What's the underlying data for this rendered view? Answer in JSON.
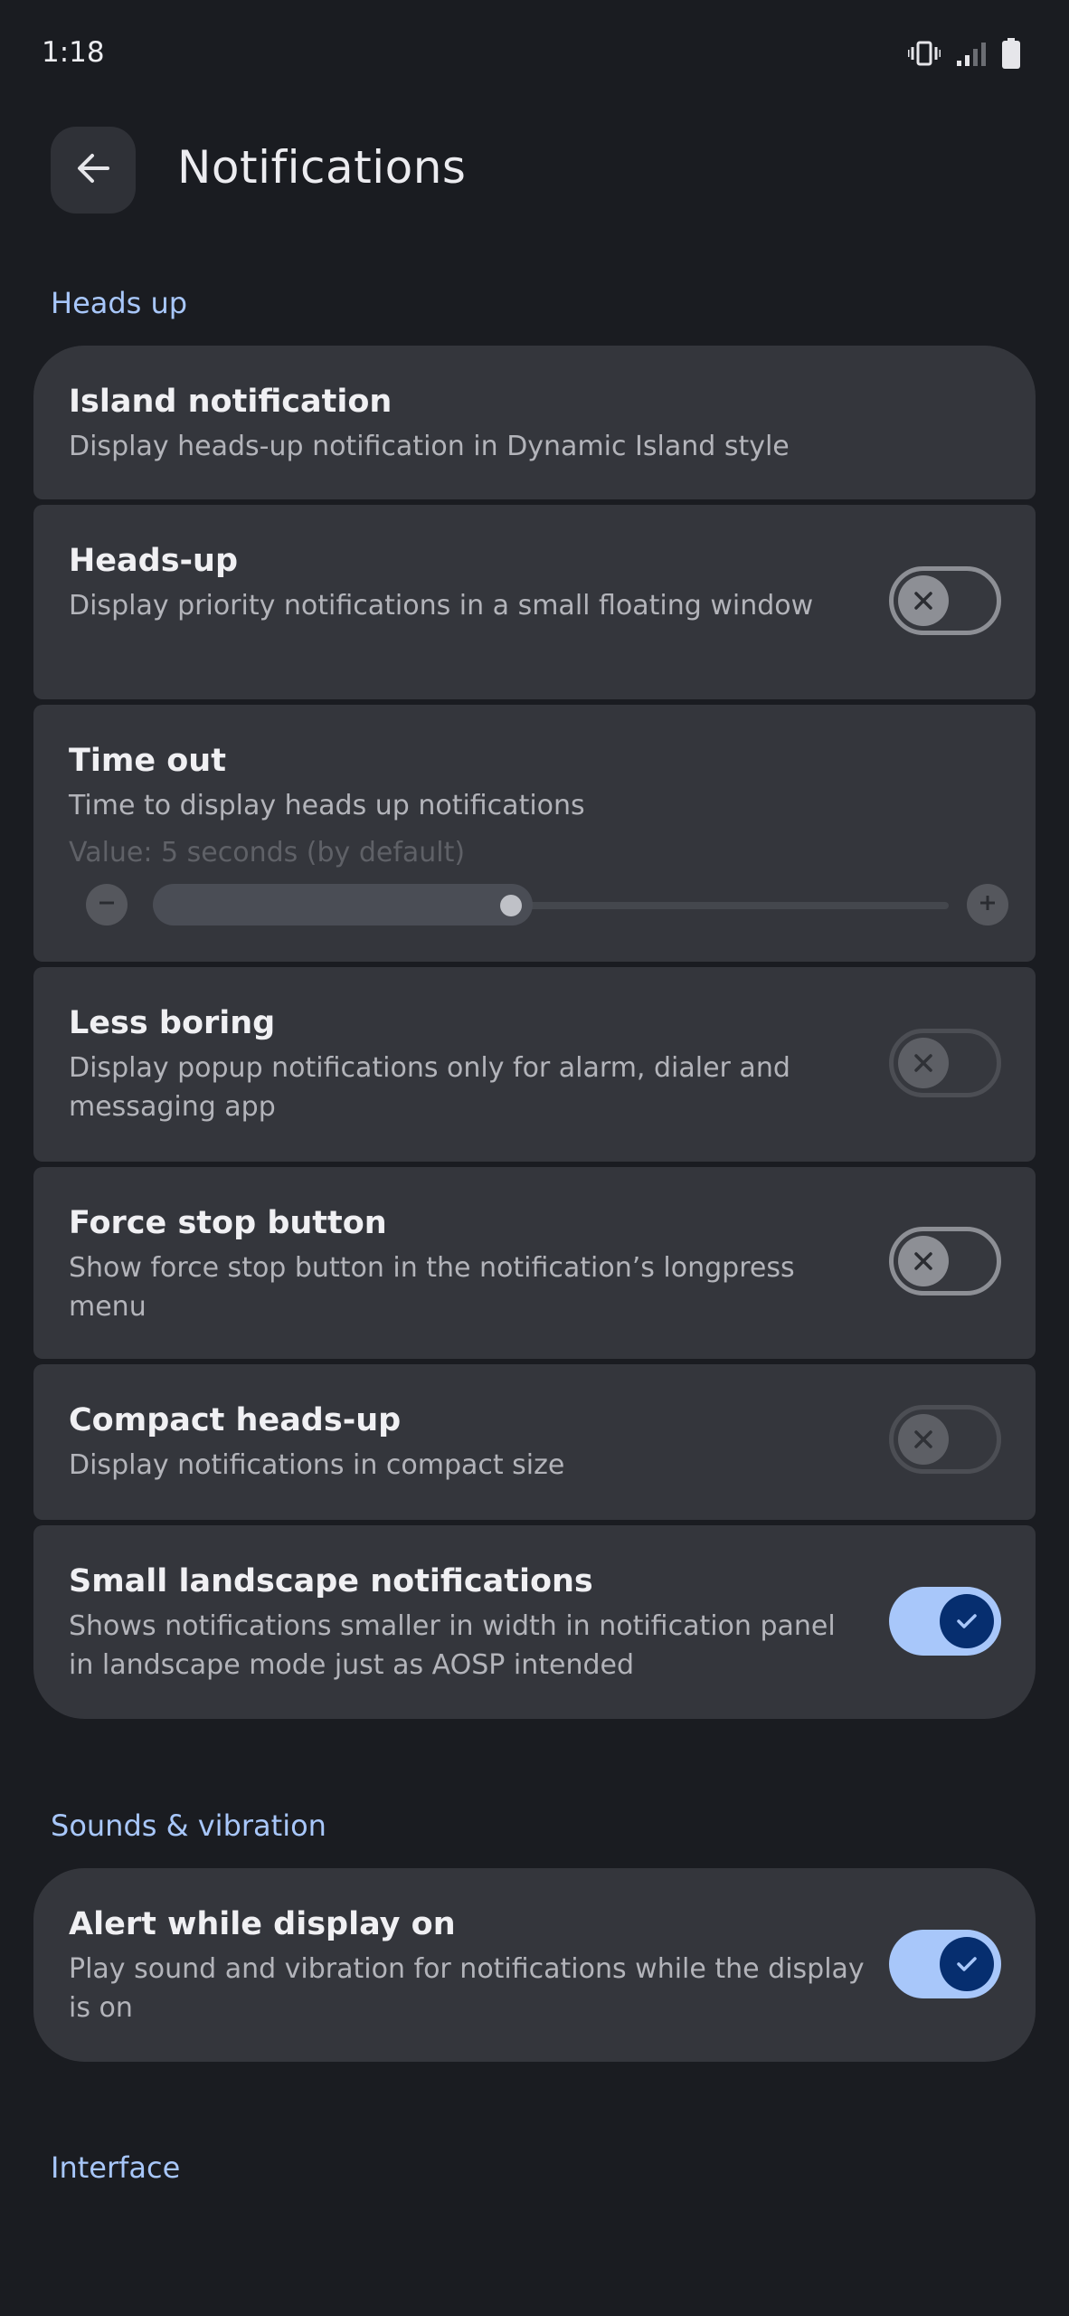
{
  "status_bar": {
    "time": "1:18",
    "icons": [
      "vibrate-icon",
      "signal-icon",
      "battery-icon"
    ]
  },
  "header": {
    "back_icon": "arrow-left-icon",
    "title": "Notifications"
  },
  "sections": {
    "heads_up": "Heads up",
    "sounds": "Sounds & vibration",
    "interface": "Interface"
  },
  "items": {
    "island": {
      "title": "Island notification",
      "subtitle": "Display heads-up notification in Dynamic Island style"
    },
    "heads_up": {
      "title": "Heads-up",
      "subtitle": "Display priority notifications in a small floating window",
      "enabled": false
    },
    "time_out": {
      "title": "Time out",
      "subtitle": "Time to display heads up notifications",
      "value_text": "Value: 5 seconds (by default)",
      "slider_fraction": 0.45
    },
    "less_boring": {
      "title": "Less boring",
      "subtitle": "Display popup notifications only for alarm, dialer and messaging app",
      "enabled": false,
      "disabled": true
    },
    "force_stop": {
      "title": "Force stop button",
      "subtitle": "Show force stop button in the notification’s longpress menu",
      "enabled": false
    },
    "compact": {
      "title": "Compact heads-up",
      "subtitle": "Display notifications in compact size",
      "enabled": false,
      "disabled": true
    },
    "small_landscape": {
      "title": "Small landscape notifications",
      "subtitle": "Shows notifications smaller in width in notification panel in landscape mode just as AOSP intended",
      "enabled": true
    },
    "alert_display_on": {
      "title": "Alert while display on",
      "subtitle": "Play sound and vibration for notifications while the display is on",
      "enabled": true
    }
  },
  "colors": {
    "background": "#1a1c21",
    "card": "#34363c",
    "accent": "#a8c7fa",
    "switch_on_knob": "#062e6f"
  }
}
